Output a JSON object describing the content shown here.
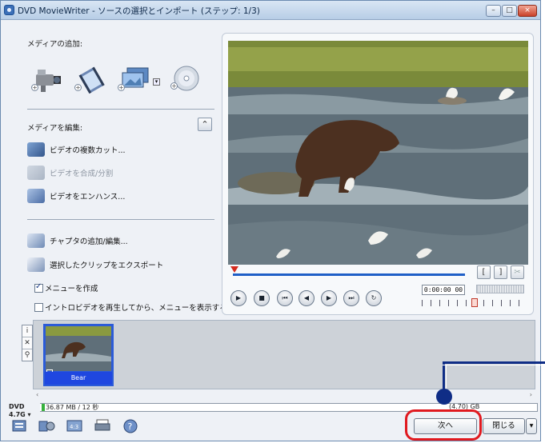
{
  "window": {
    "title": "DVD MovieWriter - ソースの選択とインポート (ステップ: 1/3)",
    "min": "–",
    "max": "□",
    "close": "×"
  },
  "add_media": {
    "label": "メディアの追加:"
  },
  "edit_media": {
    "label": "メディアを編集:",
    "collapse": "⌃",
    "items": [
      {
        "label": "ビデオの複数カット..."
      },
      {
        "label": "ビデオを合成/分割"
      },
      {
        "label": "ビデオをエンハンス..."
      }
    ]
  },
  "actions": {
    "chapters": "チャプタの追加/編集...",
    "export": "選択したクリップをエクスポート"
  },
  "options": {
    "create_menu": "メニューを作成",
    "intro_video": "イントロビデオを再生してから、メニューを表示する"
  },
  "player": {
    "timecode": "0:00:00 00"
  },
  "trim": {
    "mark_in": "[",
    "mark_out": "]",
    "cut": "✂"
  },
  "storyboard": {
    "tools": [
      "i",
      "✕",
      "⚲"
    ],
    "clip": {
      "name": "Bear"
    }
  },
  "status": {
    "disc": "DVD 4.7G",
    "used": "36.87 MB / 12 秒",
    "capacity": "(4.70) GB"
  },
  "buttons": {
    "next": "次へ",
    "close": "閉じる",
    "dropdown": "▾"
  },
  "colors": {
    "accent": "#2b5bd8",
    "highlight": "#e0191f",
    "callout": "#0f2d86"
  }
}
